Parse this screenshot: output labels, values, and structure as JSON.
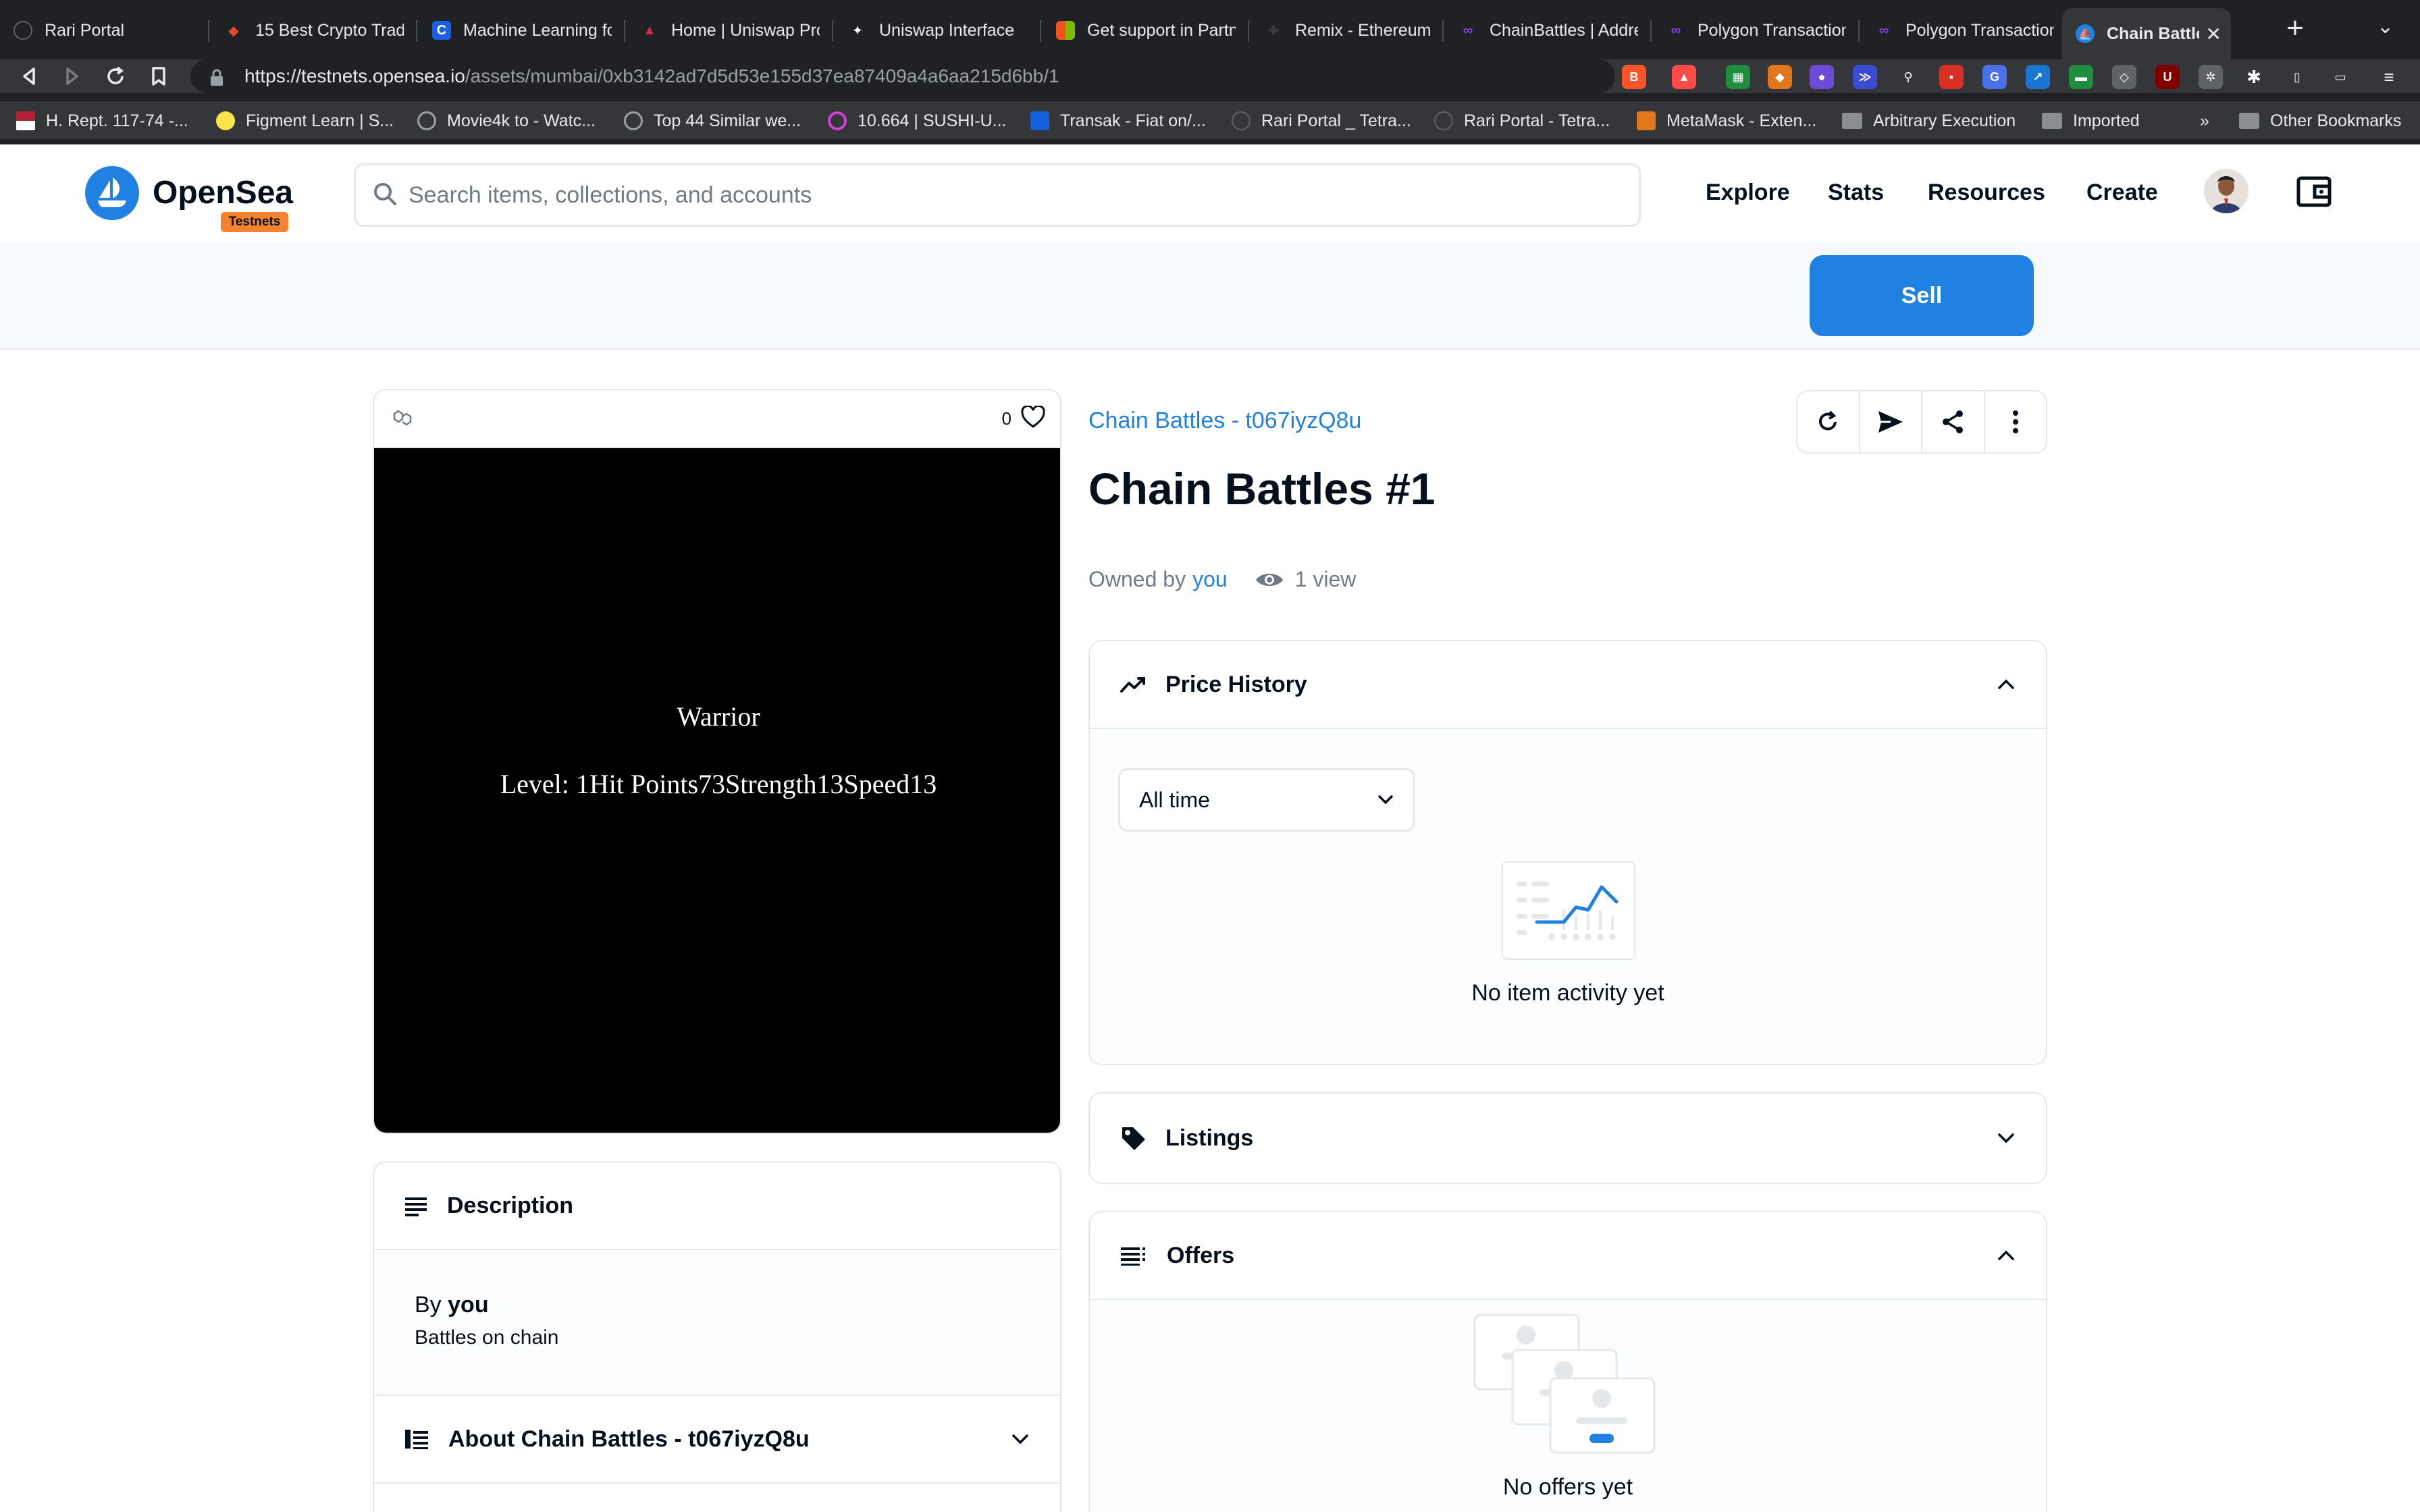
{
  "browser": {
    "tabs": [
      {
        "label": "Rari Portal",
        "icon_color": "#5f6368"
      },
      {
        "label": "15 Best Crypto Trading",
        "icon_color": "#e8472b"
      },
      {
        "label": "Machine Learning fo",
        "icon_color": "#1a5fe0"
      },
      {
        "label": "Home | Uniswap Pro",
        "icon_color": "#d02c4e"
      },
      {
        "label": "Uniswap Interface",
        "icon_color": "#ffffff"
      },
      {
        "label": "Get support in Partn",
        "icon_color": "#f25022"
      },
      {
        "label": "Remix - Ethereum ID",
        "icon_color": "#2d2d2d"
      },
      {
        "label": "ChainBattles | Addre",
        "icon_color": "#8247e5"
      },
      {
        "label": "Polygon Transaction",
        "icon_color": "#8247e5"
      },
      {
        "label": "Polygon Transaction",
        "icon_color": "#8247e5"
      },
      {
        "label": "Chain Battles #1",
        "icon_color": "#2081e2",
        "active": true
      }
    ],
    "url_host": "https://testnets.opensea.io",
    "url_path": "/assets/mumbai/0xb3142ad7d5d53e155d37ea87409a4a6aa215d6bb/1",
    "bookmarks": [
      "H. Rept. 117-74 -...",
      "Figment Learn | S...",
      "Movie4k to - Watc...",
      "Top 44 Similar we...",
      "10.664 | SUSHI-U...",
      "Transak - Fiat on/...",
      "Rari Portal _ Tetra...",
      "Rari Portal - Tetra...",
      "MetaMask - Exten...",
      "Arbitrary Execution",
      "Imported"
    ],
    "bookmarks_overflow": "»",
    "other_bookmarks": "Other Bookmarks"
  },
  "header": {
    "logo_text": "OpenSea",
    "badge": "Testnets",
    "search_placeholder": "Search items, collections, and accounts",
    "nav": [
      "Explore",
      "Stats",
      "Resources",
      "Create"
    ]
  },
  "sell_label": "Sell",
  "asset": {
    "favorites_count": "0",
    "image_class": "Warrior",
    "image_stats": "Level: 1Hit Points73Strength13Speed13",
    "collection": "Chain Battles - t067iyzQ8u",
    "title": "Chain Battles #1",
    "owned_by_label": "Owned by",
    "owner": "you",
    "views": "1 view"
  },
  "description": {
    "heading": "Description",
    "by_label": "By",
    "by_user": "you",
    "text": "Battles on chain",
    "about_heading": "About Chain Battles - t067iyzQ8u"
  },
  "price_history": {
    "heading": "Price History",
    "time_filter": "All time",
    "empty_text": "No item activity yet"
  },
  "listings": {
    "heading": "Listings"
  },
  "offers": {
    "heading": "Offers",
    "empty_text": "No offers yet"
  },
  "colors": {
    "accent": "#2081e2",
    "badge": "#f5822f",
    "text": "#04111d",
    "muted": "#707a83",
    "border": "#e5e8eb"
  }
}
